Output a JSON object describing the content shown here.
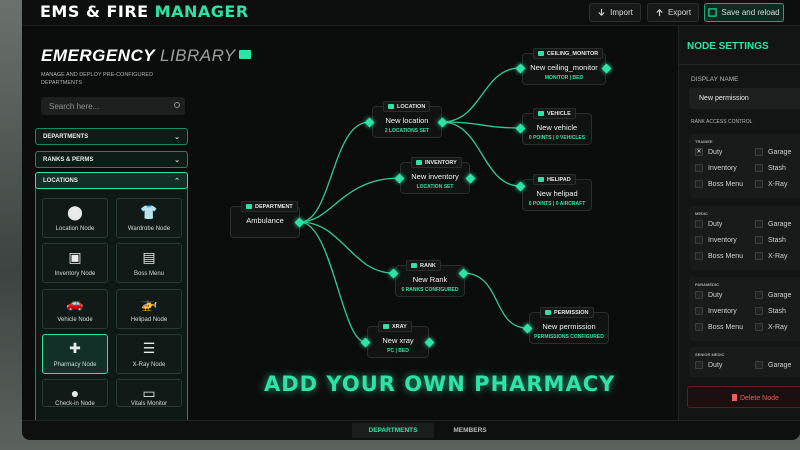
{
  "app": {
    "title_a": "EMS & FIRE ",
    "title_b": "MANAGER",
    "accent": "#2de3a7"
  },
  "header": {
    "import_label": "Import",
    "export_label": "Export",
    "save_label": "Save and reload"
  },
  "library": {
    "title_bold": "EMERGENCY",
    "title_light": "LIBRARY",
    "subtitle": "MANAGE AND DEPLOY PRE-CONFIGURED DEPARTMENTS",
    "search_placeholder": "Search here...",
    "sections": [
      "DEPARTMENTS",
      "RANKS & PERMS",
      "LOCATIONS"
    ],
    "tiles": [
      {
        "label": "Location Node",
        "icon": "location-pin-icon",
        "glyph": "⬤"
      },
      {
        "label": "Wardrobe Node",
        "icon": "shirt-icon",
        "glyph": "👕"
      },
      {
        "label": "Inventory Node",
        "icon": "box-icon",
        "glyph": "▣"
      },
      {
        "label": "Boss Menu",
        "icon": "briefcase-icon",
        "glyph": "▤"
      },
      {
        "label": "Vehicle Node",
        "icon": "car-icon",
        "glyph": "🚗"
      },
      {
        "label": "Helipad Node",
        "icon": "helicopter-icon",
        "glyph": "🚁"
      },
      {
        "label": "Pharmacy Node",
        "icon": "pharmacy-icon",
        "glyph": "✚"
      },
      {
        "label": "X-Ray Node",
        "icon": "xray-icon",
        "glyph": "☰"
      },
      {
        "label": "Check-in Node",
        "icon": "user-icon",
        "glyph": "●"
      },
      {
        "label": "Vitals Monitor",
        "icon": "monitor-icon",
        "glyph": "▭"
      }
    ]
  },
  "nodes": {
    "department": {
      "tag": "DEPARTMENT",
      "name": "Ambulance",
      "sub": ""
    },
    "location": {
      "tag": "LOCATION",
      "name": "New location",
      "sub": "2 LOCATIONS SET"
    },
    "inventory": {
      "tag": "INVENTORY",
      "name": "New inventory",
      "sub": "LOCATION SET"
    },
    "rank": {
      "tag": "RANK",
      "name": "New Rank",
      "sub": "6 RANKS CONFIGURED"
    },
    "xray": {
      "tag": "XRAY",
      "name": "New xray",
      "sub": "PC | BED"
    },
    "ceiling": {
      "tag": "CEILING_MONITOR",
      "name": "New ceiling_monitor",
      "sub": "MONITOR | BED"
    },
    "vehicle": {
      "tag": "VEHICLE",
      "name": "New vehicle",
      "sub": "0 POINTS | 0 VEHICLES"
    },
    "helipad": {
      "tag": "HELIPAD",
      "name": "New helipad",
      "sub": "0 POINTS | 0 AIRCRAFT"
    },
    "permission": {
      "tag": "PERMISSION",
      "name": "New permission",
      "sub": "PERMISSIONS CONFIGURED"
    }
  },
  "promo": "ADD YOUR OWN PHARMACY",
  "settings": {
    "heading": "NODE SETTINGS",
    "display_name_label": "DISPLAY NAME",
    "display_name_value": "New permission",
    "rank_access_label": "RANK ACCESS CONTROL",
    "ranks": [
      {
        "name": "TRAINEE",
        "perms": [
          {
            "l": "Duty",
            "c": true
          },
          {
            "l": "Garage",
            "c": false
          },
          {
            "l": "Inventory",
            "c": false
          },
          {
            "l": "Stash",
            "c": false
          },
          {
            "l": "Boss Menu",
            "c": false
          },
          {
            "l": "X-Ray",
            "c": false
          }
        ]
      },
      {
        "name": "MEDIC",
        "perms": [
          {
            "l": "Duty",
            "c": false
          },
          {
            "l": "Garage",
            "c": false
          },
          {
            "l": "Inventory",
            "c": false
          },
          {
            "l": "Stash",
            "c": false
          },
          {
            "l": "Boss Menu",
            "c": false
          },
          {
            "l": "X-Ray",
            "c": false
          }
        ]
      },
      {
        "name": "PARAMEDIC",
        "perms": [
          {
            "l": "Duty",
            "c": false
          },
          {
            "l": "Garage",
            "c": false
          },
          {
            "l": "Inventory",
            "c": false
          },
          {
            "l": "Stash",
            "c": false
          },
          {
            "l": "Boss Menu",
            "c": false
          },
          {
            "l": "X-Ray",
            "c": false
          }
        ]
      },
      {
        "name": "SENIOR MEDIC",
        "perms": [
          {
            "l": "Duty",
            "c": false
          },
          {
            "l": "Garage",
            "c": false
          }
        ]
      }
    ],
    "delete_label": "Delete Node"
  },
  "tabs": [
    "DEPARTMENTS",
    "MEMBERS"
  ]
}
